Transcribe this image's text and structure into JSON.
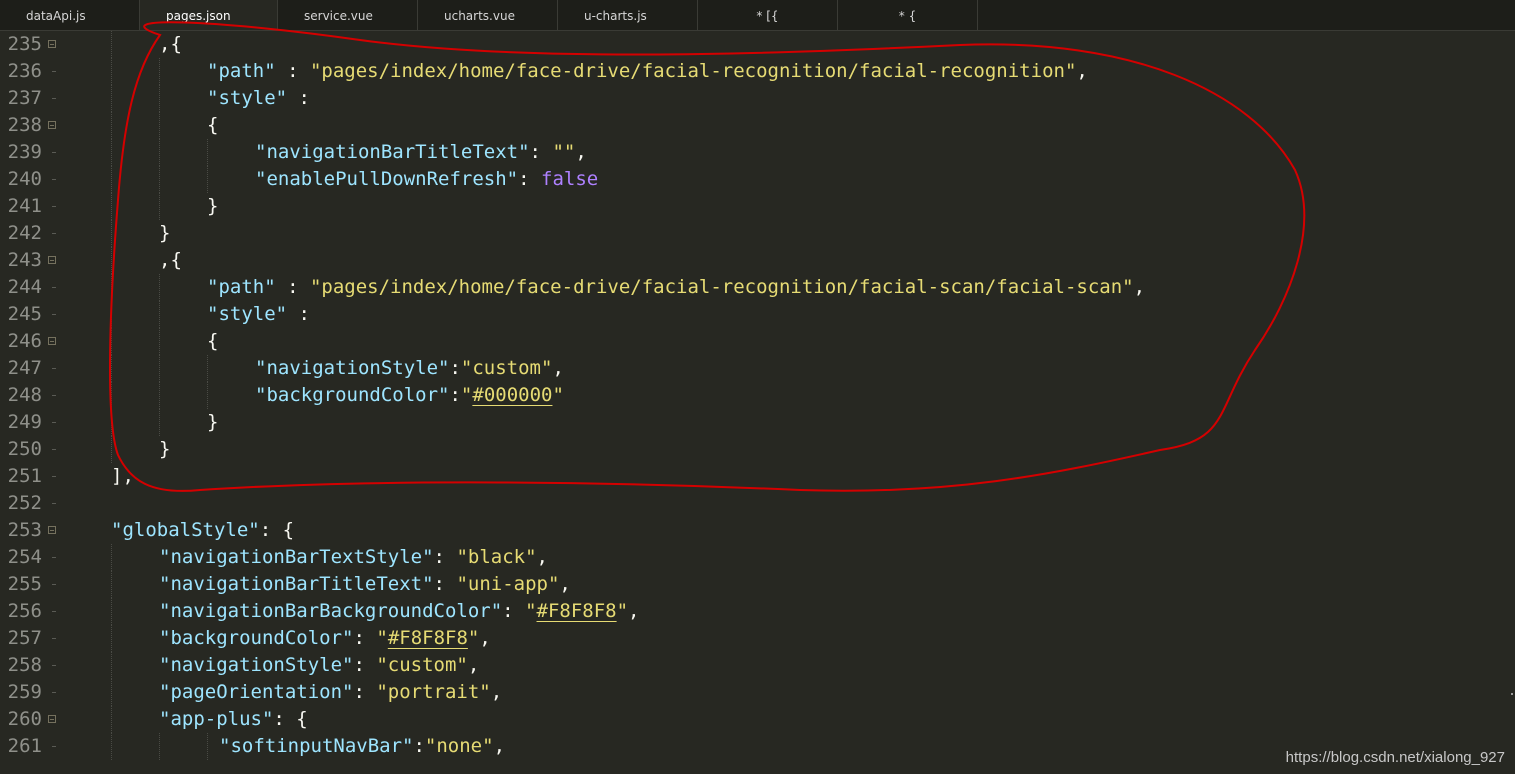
{
  "tabs": [
    {
      "label": "dataApi.js",
      "active": false
    },
    {
      "label": "pages.json",
      "active": true
    },
    {
      "label": "service.vue",
      "active": false
    },
    {
      "label": "ucharts.vue",
      "active": false
    },
    {
      "label": "u-charts.js",
      "active": false
    },
    {
      "label": "* [{",
      "active": false
    },
    {
      "label": "* {",
      "active": false
    }
  ],
  "lines": [
    {
      "n": "235",
      "fold": true,
      "tokens": [
        [
          "pun",
          ",{"
        ]
      ]
    },
    {
      "n": "236",
      "fold": false,
      "tokens": [
        [
          "key",
          "\"path\""
        ],
        [
          "pun",
          " : "
        ],
        [
          "str",
          "\"pages/index/home/face-drive/facial-recognition/facial-recognition\""
        ],
        [
          "pun",
          ","
        ]
      ]
    },
    {
      "n": "237",
      "fold": false,
      "tokens": [
        [
          "key",
          "\"style\""
        ],
        [
          "pun",
          " :"
        ]
      ]
    },
    {
      "n": "238",
      "fold": true,
      "tokens": [
        [
          "pun",
          "{"
        ]
      ]
    },
    {
      "n": "239",
      "fold": false,
      "tokens": [
        [
          "key",
          "\"navigationBarTitleText\""
        ],
        [
          "pun",
          ": "
        ],
        [
          "str",
          "\"\""
        ],
        [
          "pun",
          ","
        ]
      ]
    },
    {
      "n": "240",
      "fold": false,
      "tokens": [
        [
          "key",
          "\"enablePullDownRefresh\""
        ],
        [
          "pun",
          ": "
        ],
        [
          "kw",
          "false"
        ]
      ]
    },
    {
      "n": "241",
      "fold": false,
      "tokens": [
        [
          "pun",
          "}"
        ]
      ]
    },
    {
      "n": "242",
      "fold": false,
      "tokens": [
        [
          "pun",
          "}"
        ]
      ]
    },
    {
      "n": "243",
      "fold": true,
      "tokens": [
        [
          "pun",
          ",{"
        ]
      ]
    },
    {
      "n": "244",
      "fold": false,
      "tokens": [
        [
          "key",
          "\"path\""
        ],
        [
          "pun",
          " : "
        ],
        [
          "str",
          "\"pages/index/home/face-drive/facial-recognition/facial-scan/facial-scan\""
        ],
        [
          "pun",
          ","
        ]
      ]
    },
    {
      "n": "245",
      "fold": false,
      "tokens": [
        [
          "key",
          "\"style\""
        ],
        [
          "pun",
          " :"
        ]
      ]
    },
    {
      "n": "246",
      "fold": true,
      "tokens": [
        [
          "pun",
          "{"
        ]
      ]
    },
    {
      "n": "247",
      "fold": false,
      "tokens": [
        [
          "key",
          "\"navigationStyle\""
        ],
        [
          "pun",
          ":"
        ],
        [
          "str",
          "\"custom\""
        ],
        [
          "pun",
          ","
        ]
      ]
    },
    {
      "n": "248",
      "fold": false,
      "tokens": [
        [
          "key",
          "\"backgroundColor\""
        ],
        [
          "pun",
          ":"
        ],
        [
          "str",
          "\""
        ],
        [
          "hex",
          "#000000"
        ],
        [
          "str",
          "\""
        ]
      ]
    },
    {
      "n": "249",
      "fold": false,
      "tokens": [
        [
          "pun",
          "}"
        ]
      ]
    },
    {
      "n": "250",
      "fold": false,
      "tokens": [
        [
          "pun",
          "}"
        ]
      ]
    },
    {
      "n": "251",
      "fold": false,
      "tokens": [
        [
          "pun",
          "],"
        ]
      ]
    },
    {
      "n": "252",
      "fold": false,
      "tokens": []
    },
    {
      "n": "253",
      "fold": true,
      "tokens": [
        [
          "key",
          "\"globalStyle\""
        ],
        [
          "pun",
          ": {"
        ]
      ]
    },
    {
      "n": "254",
      "fold": false,
      "tokens": [
        [
          "key",
          "\"navigationBarTextStyle\""
        ],
        [
          "pun",
          ": "
        ],
        [
          "str",
          "\"black\""
        ],
        [
          "pun",
          ","
        ]
      ]
    },
    {
      "n": "255",
      "fold": false,
      "tokens": [
        [
          "key",
          "\"navigationBarTitleText\""
        ],
        [
          "pun",
          ": "
        ],
        [
          "str",
          "\"uni-app\""
        ],
        [
          "pun",
          ","
        ]
      ]
    },
    {
      "n": "256",
      "fold": false,
      "tokens": [
        [
          "key",
          "\"navigationBarBackgroundColor\""
        ],
        [
          "pun",
          ": "
        ],
        [
          "str",
          "\""
        ],
        [
          "hex",
          "#F8F8F8"
        ],
        [
          "str",
          "\""
        ],
        [
          "pun",
          ","
        ]
      ]
    },
    {
      "n": "257",
      "fold": false,
      "tokens": [
        [
          "key",
          "\"backgroundColor\""
        ],
        [
          "pun",
          ": "
        ],
        [
          "str",
          "\""
        ],
        [
          "hex",
          "#F8F8F8"
        ],
        [
          "str",
          "\""
        ],
        [
          "pun",
          ","
        ]
      ]
    },
    {
      "n": "258",
      "fold": false,
      "tokens": [
        [
          "key",
          "\"navigationStyle\""
        ],
        [
          "pun",
          ": "
        ],
        [
          "str",
          "\"custom\""
        ],
        [
          "pun",
          ","
        ]
      ]
    },
    {
      "n": "259",
      "fold": false,
      "tokens": [
        [
          "key",
          "\"pageOrientation\""
        ],
        [
          "pun",
          ": "
        ],
        [
          "str",
          "\"portrait\""
        ],
        [
          "pun",
          ","
        ]
      ]
    },
    {
      "n": "260",
      "fold": true,
      "tokens": [
        [
          "key",
          "\"app-plus\""
        ],
        [
          "pun",
          ": {"
        ]
      ]
    },
    {
      "n": "261",
      "fold": false,
      "tokens": [
        [
          "key",
          "\"softinputNavBar\""
        ],
        [
          "pun",
          ":"
        ],
        [
          "str",
          "\"none\""
        ],
        [
          "pun",
          ","
        ]
      ]
    }
  ],
  "watermark": "https://blog.csdn.net/xialong_927",
  "colors": {
    "background": "#272822",
    "tabbar": "#1d1e19",
    "key": "#9ee5ff",
    "string": "#e6db74",
    "keyword": "#ae81ff",
    "annotation": "#d40000"
  }
}
